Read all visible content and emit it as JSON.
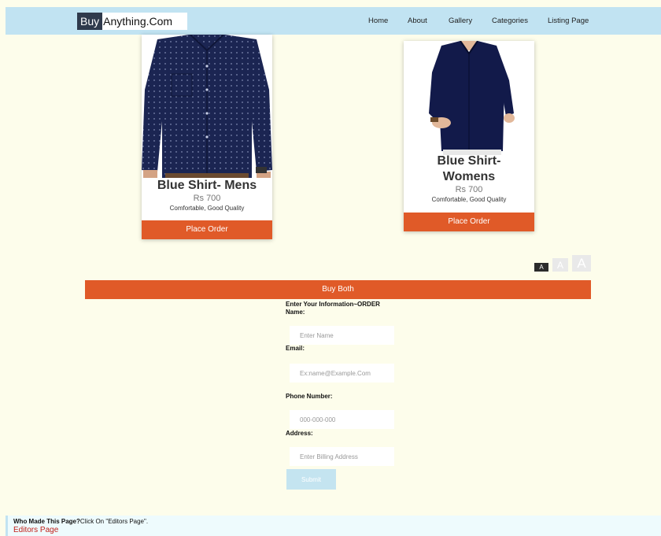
{
  "navbar": {
    "brand_highlight": "Buy",
    "brand_rest": "Anything.Com",
    "links": [
      "Home",
      "About",
      "Gallery",
      "Categories",
      "Listing Page"
    ]
  },
  "products": [
    {
      "title": "Blue Shirt- Mens",
      "price": "Rs 700",
      "description": "Comfortable, Good Quality",
      "button": "Place Order"
    },
    {
      "title": "Blue Shirt- Womens",
      "price": "Rs 700",
      "description": "Comfortable, Good Quality",
      "button": "Place Order"
    }
  ],
  "font_size_controls": [
    "A",
    "A",
    "A"
  ],
  "buy_both_label": "Buy Both",
  "form": {
    "heading": "Enter Your Information~ORDER",
    "name_label": "Name:",
    "name_placeholder": "Enter Name",
    "email_label": "Email:",
    "email_placeholder": "Ex:name@Example.Com",
    "phone_label": "Phone Number:",
    "phone_placeholder": "000-000-000",
    "address_label": "Address:",
    "address_placeholder": "Enter Billing Address",
    "submit_label": "Submit"
  },
  "footer": {
    "question": "Who Made This Page?",
    "instruction": "Click On \"Editors Page\".",
    "link": "Editors Page"
  },
  "colors": {
    "navbar": "#c1e3f2",
    "page_background": "#fdfdeb",
    "accent_orange": "#e05a28",
    "shirt_navy": "#1b2552",
    "footer_link": "#c0201a"
  }
}
